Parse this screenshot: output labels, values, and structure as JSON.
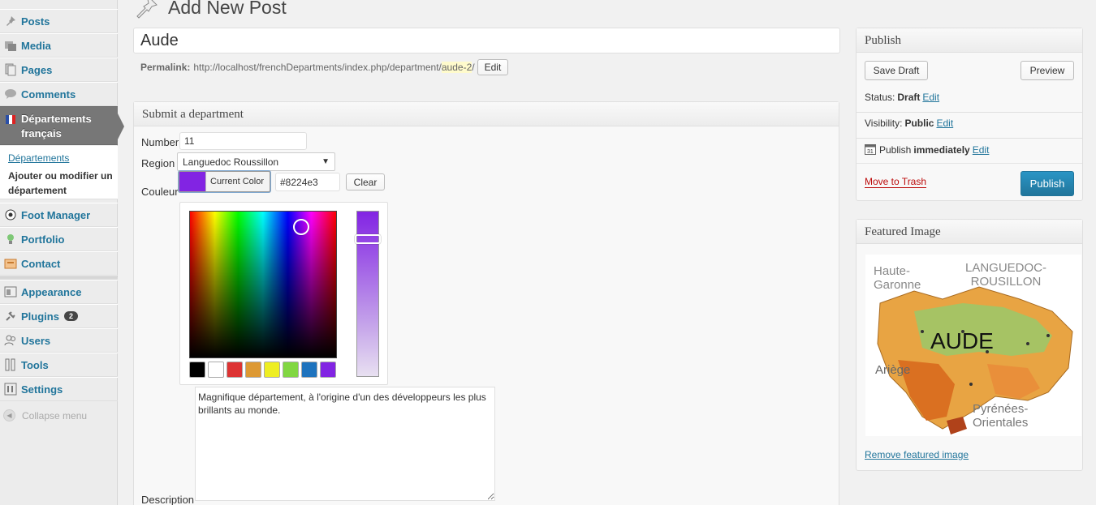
{
  "sidebar": {
    "items": [
      {
        "label": "Posts",
        "icon": "pushpin-icon"
      },
      {
        "label": "Media",
        "icon": "media-icon"
      },
      {
        "label": "Pages",
        "icon": "pages-icon"
      },
      {
        "label": "Comments",
        "icon": "comments-icon"
      },
      {
        "label": "Départements français",
        "icon": "flag-icon"
      },
      {
        "label": "Foot Manager",
        "icon": "soccer-ball-icon"
      },
      {
        "label": "Portfolio",
        "icon": "lightbulb-icon"
      },
      {
        "label": "Contact",
        "icon": "contact-icon"
      },
      {
        "label": "Appearance",
        "icon": "appearance-icon"
      },
      {
        "label": "Plugins",
        "icon": "plugins-icon",
        "badge": "2"
      },
      {
        "label": "Users",
        "icon": "users-icon"
      },
      {
        "label": "Tools",
        "icon": "tools-icon"
      },
      {
        "label": "Settings",
        "icon": "settings-icon"
      }
    ],
    "submenu": [
      "Départements",
      "Ajouter ou modifier un département"
    ],
    "collapse_label": "Collapse menu"
  },
  "header": {
    "title": "Add New Post"
  },
  "post": {
    "title": "Aude",
    "permalink_label": "Permalink:",
    "permalink_base": "http://localhost/frenchDepartments/index.php/department/",
    "permalink_slug": "aude-2",
    "permalink_suffix": "/",
    "edit_label": "Edit"
  },
  "department_box": {
    "title": "Submit a department",
    "number_label": "Number",
    "number_value": "11",
    "region_label": "Region",
    "region_value": "Languedoc Roussillon",
    "color_label": "Couleur",
    "current_color_label": "Current Color",
    "color_hex": "#8224e3",
    "clear_label": "Clear",
    "palette": [
      "#000000",
      "#ffffff",
      "#dd3333",
      "#dd9933",
      "#eeee22",
      "#81d742",
      "#1e73be",
      "#8224e3"
    ],
    "description_label": "Description",
    "description_value": "Magnifique département, à l'origine d'un des développeurs les plus brillants au monde."
  },
  "publish": {
    "title": "Publish",
    "save_draft": "Save Draft",
    "preview": "Preview",
    "status_label": "Status:",
    "status_value": "Draft",
    "visibility_label": "Visibility:",
    "visibility_value": "Public",
    "publish_label": "Publish",
    "publish_value": "immediately",
    "edit": "Edit",
    "trash": "Move to Trash",
    "publish_button": "Publish"
  },
  "featured": {
    "title": "Featured Image",
    "remove_label": "Remove featured image",
    "map_labels": {
      "haute_garonne": "Haute-\nGaronne",
      "languedoc": "LANGUEDOC-\nROUSILLON",
      "aude": "AUDE",
      "ariege": "Ariège",
      "pyrenees": "Pyrénées-\nOrientales"
    }
  },
  "colors": {
    "accent": "#21759b",
    "trash": "#bc0b0b",
    "selected_color": "#8224e3"
  }
}
